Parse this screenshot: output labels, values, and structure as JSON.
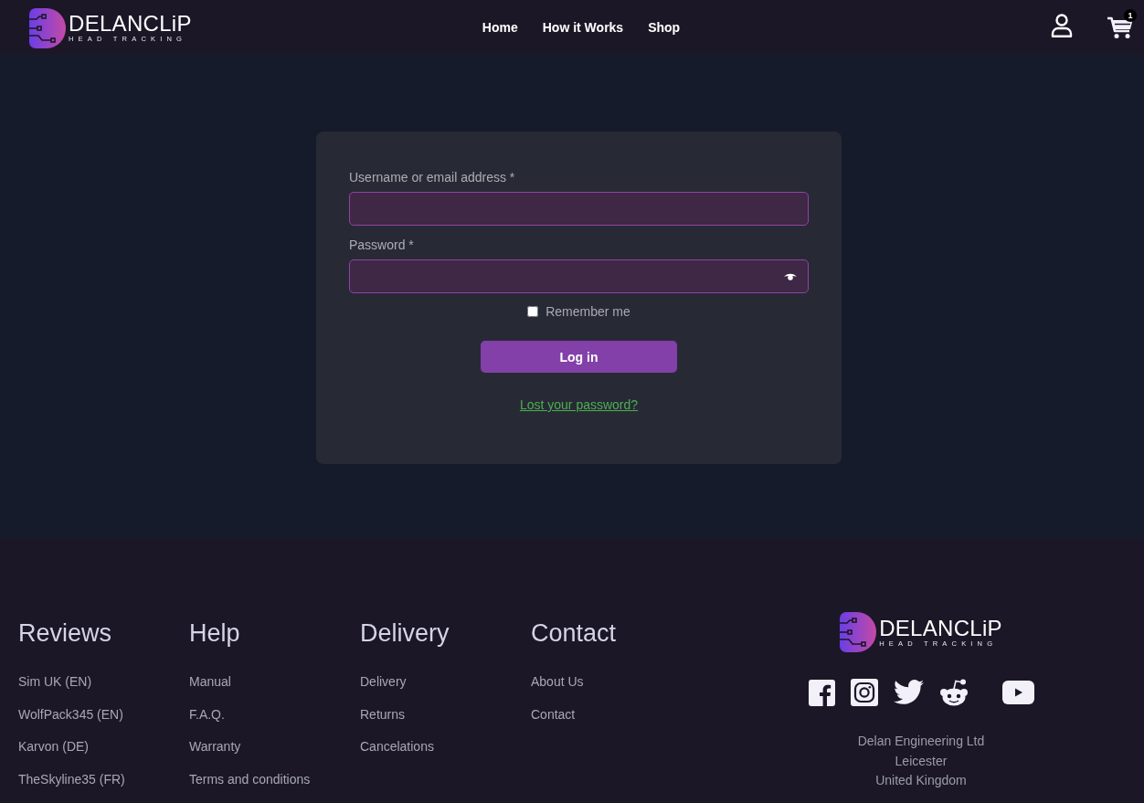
{
  "header": {
    "logo": {
      "name": "DELANCLiP",
      "tagline": "HEAD TRACKING"
    },
    "nav": [
      {
        "label": "Home"
      },
      {
        "label": "How it Works"
      },
      {
        "label": "Shop"
      }
    ],
    "cart_count": "1"
  },
  "login_form": {
    "fields": [
      {
        "kind": "text",
        "label": "Username or email address *"
      },
      {
        "kind": "password",
        "label": "Password *"
      }
    ],
    "remember_me": {
      "label": "Remember me",
      "checked": false
    },
    "submit": "Log in",
    "lost_password": "Lost your password?"
  },
  "footer": {
    "columns": [
      {
        "title": "Reviews",
        "links": [
          "Sim UK (EN)",
          "WolfPack345 (EN)",
          "Karvon (DE)",
          "TheSkyline35 (FR)"
        ]
      },
      {
        "title": "Help",
        "links": [
          "Manual",
          "F.A.Q.",
          "Warranty",
          "Terms and conditions"
        ]
      },
      {
        "title": "Delivery",
        "links": [
          "Delivery",
          "Returns",
          "Cancelations"
        ]
      },
      {
        "title": "Contact",
        "links": [
          "About Us",
          "Contact"
        ]
      }
    ],
    "logo": {
      "name": "DELANCLiP",
      "tagline": "HEAD TRACKING"
    },
    "address": [
      "Delan Engineering Ltd",
      "Leicester",
      "United Kingdom"
    ]
  }
}
